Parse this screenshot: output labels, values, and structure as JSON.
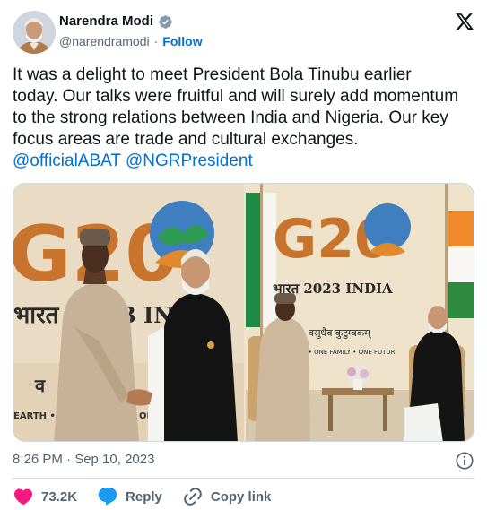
{
  "author": {
    "name": "Narendra Modi",
    "handle": "@narendramodi",
    "separator": "·",
    "follow_label": "Follow"
  },
  "tweet": {
    "text": "It was a delight to meet President Bola Tinubu earlier today. Our talks were fruitful and will surely add momentum to the strong relations between India and Nigeria. Our key focus areas are trade and cultural exchanges. ",
    "mentions": [
      "@officialABAT",
      "@NGRPresident"
    ]
  },
  "media": {
    "photo1": {
      "letters": "G20",
      "partial_text": "भारत",
      "partial_text2": "3 INI",
      "partial_text3": "EARTH •",
      "partial_text4": "ON",
      "partial_text5": "व"
    },
    "photo2": {
      "letters": "G20",
      "year_line": "भारत 2023 INDIA",
      "hindi_line": "वसुधैव कुटुम्बकम्",
      "motto_line": "TH • ONE FAMILY • ONE FUTUR"
    }
  },
  "footer": {
    "timestamp": "8:26 PM · Sep 10, 2023",
    "like_count": "73.2K",
    "reply_label": "Reply",
    "copy_link_label": "Copy link"
  },
  "icons": {
    "verified": "verified-badge-icon",
    "x_logo": "x-logo-icon",
    "info": "info-icon",
    "like": "heart-icon",
    "reply": "reply-bubble-icon",
    "link": "link-icon"
  },
  "colors": {
    "accent": "#006fd6",
    "like": "#f91880",
    "secondary_text": "#536471"
  }
}
